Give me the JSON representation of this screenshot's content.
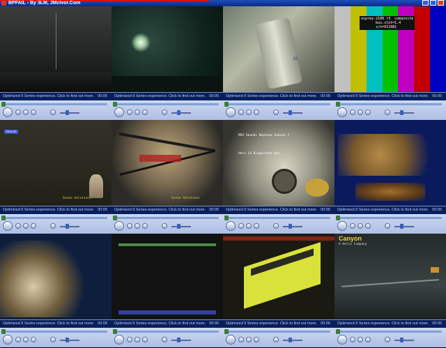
{
  "window": {
    "title": "BPFAIL - By 3LM, JMcIvor.Com",
    "controls": [
      "minimize-icon",
      "maximize-icon",
      "close-icon"
    ]
  },
  "players": [
    {
      "status": "Optimized 9 Series experience.  Click to find out more.",
      "time": "00:05",
      "overlay_text": "",
      "overlay_text2": ""
    },
    {
      "status": "Optimized 9 Series experience.  Click to find out more.",
      "time": "00:05",
      "overlay_text": "",
      "overlay_text2": ""
    },
    {
      "status": "Optimized 9 Series experience.  Click to find out more.",
      "time": "00:05",
      "overlay_text": "10",
      "overlay_text2": ""
    },
    {
      "status": "Optimized 9 Series experience.  Click to find out more.",
      "time": "00:05",
      "overlay_text": "osprey-2100 r3  composite\n       bus.slot=1.4\n       s/n=911881",
      "overlay_text2": ""
    },
    {
      "status": "Optimized 9 Series experience.  Click to find out more.",
      "time": "00:05",
      "overlay_text": "Skandi",
      "overlay_text2": "Ocean Solutions"
    },
    {
      "status": "Optimized 9 Series experience.  Click to find out more.",
      "time": "00:05",
      "overlay_text": "",
      "overlay_text2": "Ocean Solutions"
    },
    {
      "status": "Optimized 9 Series experience.  Click to find out more.",
      "time": "00:05",
      "overlay_text": "MSV Skandi Neptune         Subsea 7",
      "overlay_text2": "Hero 14  Dispersant Ops."
    },
    {
      "status": "Optimized 9 Series experience.  Click to find out more.",
      "time": "00:05",
      "overlay_text": "",
      "overlay_text2": ""
    },
    {
      "status": "Optimized 9 Series experience.  Click to find out more.",
      "time": "00:06",
      "overlay_text": "",
      "overlay_text2": ""
    },
    {
      "status": "Optimized 9 Series experience.  Click to find out more.",
      "time": "00:06",
      "overlay_text": "",
      "overlay_text2": ""
    },
    {
      "status": "Optimized 9 Series experience.  Click to find out more.",
      "time": "00:06",
      "overlay_text": "",
      "overlay_text2": ""
    },
    {
      "status": "Optimized 9 Series experience.  Click to find out more.",
      "time": "00:06",
      "overlay_text": "Canyon",
      "overlay_text2": "A Helix Company"
    }
  ],
  "player_buttons": [
    "play-pause-icon",
    "stop-icon",
    "previous-icon",
    "next-icon",
    "mute-icon",
    "volume-slider"
  ],
  "colors": {
    "title_bar": "#0a2a86",
    "info_bar": "#0a1f5a",
    "control_bar": "#aebfe4",
    "seek_track": "#7ea0d8",
    "seek_thumb": "#3b7d3b",
    "canyon_label": "#f0d040"
  }
}
